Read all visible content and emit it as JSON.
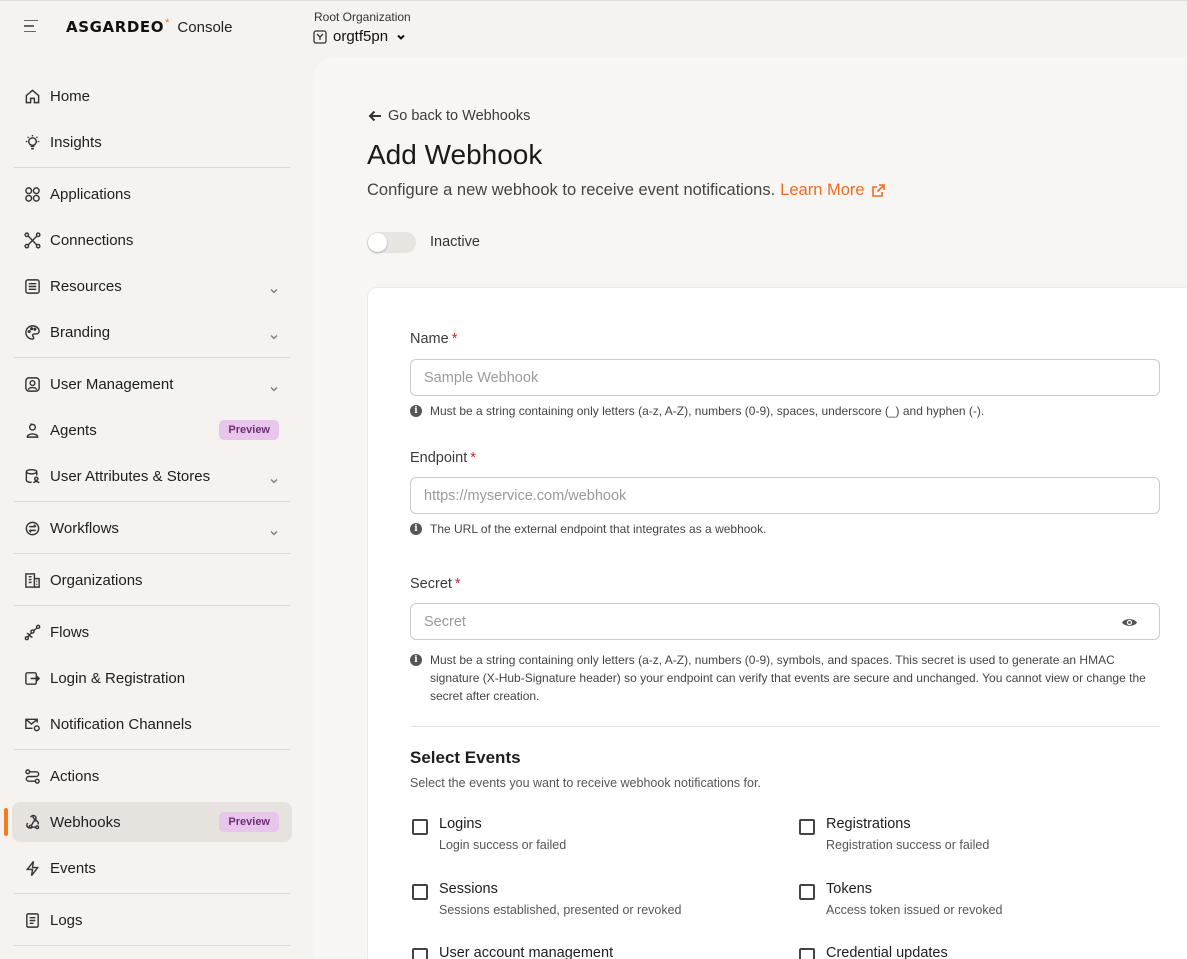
{
  "brand": {
    "logo": "ASGARDEO",
    "star": "*",
    "product": "Console"
  },
  "org": {
    "label": "Root Organization",
    "name": "orgtf5pn"
  },
  "sidebar": {
    "items": [
      {
        "label": "Home"
      },
      {
        "label": "Insights"
      },
      {
        "label": "Applications"
      },
      {
        "label": "Connections"
      },
      {
        "label": "Resources"
      },
      {
        "label": "Branding"
      },
      {
        "label": "User Management"
      },
      {
        "label": "Agents",
        "badge": "Preview"
      },
      {
        "label": "User Attributes & Stores"
      },
      {
        "label": "Workflows"
      },
      {
        "label": "Organizations"
      },
      {
        "label": "Flows"
      },
      {
        "label": "Login & Registration"
      },
      {
        "label": "Notification Channels"
      },
      {
        "label": "Actions"
      },
      {
        "label": "Webhooks",
        "badge": "Preview",
        "active": true
      },
      {
        "label": "Events"
      },
      {
        "label": "Logs"
      }
    ]
  },
  "page": {
    "back_link": "Go back to Webhooks",
    "title": "Add Webhook",
    "subtitle": "Configure a new webhook to receive event notifications.",
    "learn_more": "Learn More",
    "status_label": "Inactive"
  },
  "form": {
    "name": {
      "label": "Name",
      "required_mark": "*",
      "placeholder": "Sample Webhook",
      "hint": "Must be a string containing only letters (a-z, A-Z), numbers (0-9), spaces, underscore (_) and hyphen (-)."
    },
    "endpoint": {
      "label": "Endpoint",
      "required_mark": "*",
      "placeholder": "https://myservice.com/webhook",
      "hint": "The URL of the external endpoint that integrates as a webhook."
    },
    "secret": {
      "label": "Secret",
      "required_mark": "*",
      "placeholder": "Secret",
      "hint": "Must be a string containing only letters (a-z, A-Z), numbers (0-9), symbols, and spaces. This secret is used to generate an HMAC signature (X-Hub-Signature header) so your endpoint can verify that events are secure and unchanged. You cannot view or change the secret after creation."
    }
  },
  "events": {
    "title": "Select Events",
    "subtitle": "Select the events you want to receive webhook notifications for.",
    "items": [
      {
        "title": "Logins",
        "desc": "Login success or failed"
      },
      {
        "title": "Registrations",
        "desc": "Registration success or failed"
      },
      {
        "title": "Sessions",
        "desc": "Sessions established, presented or revoked"
      },
      {
        "title": "Tokens",
        "desc": "Access token issued or revoked"
      },
      {
        "title": "User account management",
        "desc": ""
      },
      {
        "title": "Credential updates",
        "desc": ""
      }
    ]
  },
  "colors": {
    "accent": "#f47b20",
    "link": "#f16c1f",
    "badge_bg": "#e8c6ec",
    "badge_text": "#6b2e73"
  }
}
